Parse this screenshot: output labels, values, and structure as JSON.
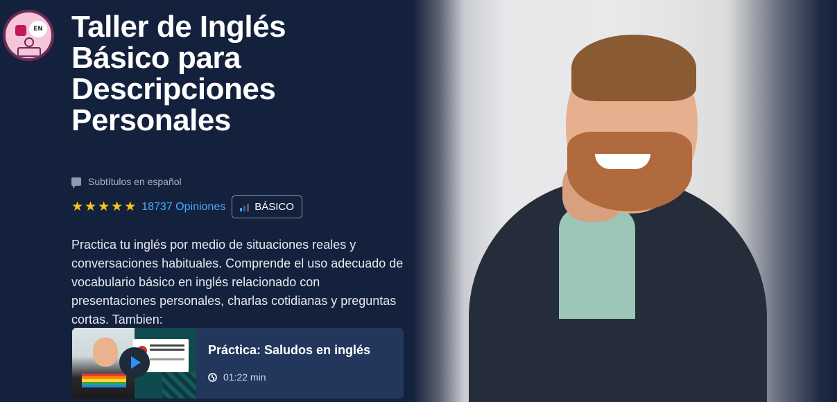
{
  "course": {
    "logo_badge": "EN",
    "title": "Taller de Inglés Básico para Descripciones Personales",
    "subtitles": "Subtítulos en español",
    "rating_stars": 5,
    "reviews": "18737 Opiniones",
    "level": "BÁSICO",
    "description": "Practica tu inglés por medio de situaciones reales y conversaciones habituales. Comprende el uso adecuado de vocabulario básico en inglés relacionado con presentaciones personales, charlas cotidianas y preguntas cortas. Tambien:"
  },
  "preview_card": {
    "title": "Práctica: Saludos en inglés",
    "duration": "01:22 min"
  },
  "colors": {
    "background": "#14213d",
    "card": "#23375c",
    "link": "#4aa8ff",
    "star": "#f5c518"
  },
  "icons": [
    "chat-icon",
    "star-icon",
    "level-bars-icon",
    "play-icon",
    "clock-icon"
  ]
}
